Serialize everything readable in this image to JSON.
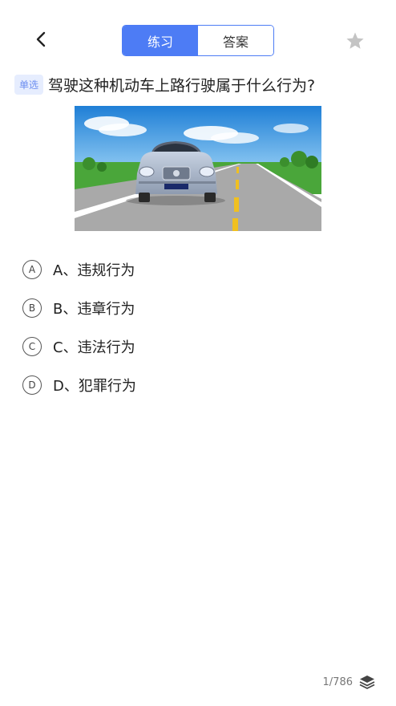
{
  "header": {
    "back_icon": "chevron-left-icon",
    "tabs": [
      {
        "label": "练习",
        "active": true
      },
      {
        "label": "答案",
        "active": false
      }
    ],
    "star_icon": "star-icon",
    "accent_color": "#4d7cf5"
  },
  "question": {
    "type_badge": "单选",
    "text": "驾驶这种机动车上路行驶属于什么行为?"
  },
  "options": [
    {
      "letter": "A",
      "text": "A、违规行为"
    },
    {
      "letter": "B",
      "text": "B、违章行为"
    },
    {
      "letter": "C",
      "text": "C、违法行为"
    },
    {
      "letter": "D",
      "text": "D、犯罪行为"
    }
  ],
  "footer": {
    "counter": "1/786",
    "layers_icon": "layers-icon"
  }
}
